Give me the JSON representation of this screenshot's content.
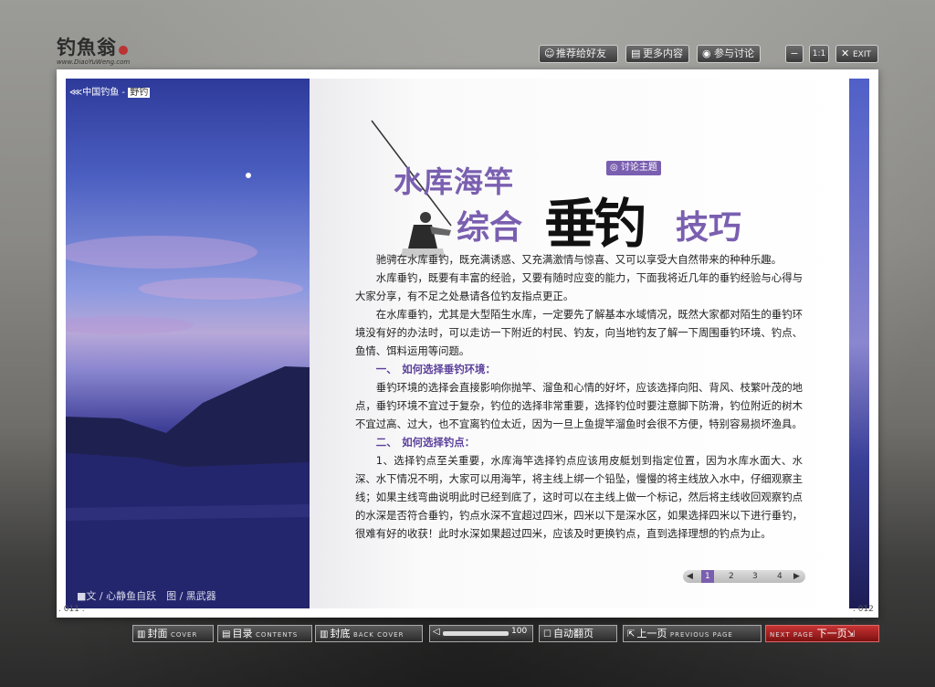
{
  "header": {
    "logo_cn": "钓魚翁",
    "logo_en": "www.DiaoYuWeng.com",
    "buttons": [
      {
        "label": "推荐给好友",
        "icon": "user-recommend-icon"
      },
      {
        "label": "更多内容",
        "icon": "document-icon"
      },
      {
        "label": "参与讨论",
        "icon": "chat-bubble-icon"
      }
    ],
    "window_buttons": [
      {
        "label": "−",
        "name": "minimize"
      },
      {
        "label": "1:1",
        "name": "actual-size"
      },
      {
        "label": "EXIT",
        "name": "exit"
      }
    ]
  },
  "left_page": {
    "category": "中国钓鱼 - ",
    "category_highlight": "野钓",
    "credit": "■文 / 心静鱼自跃　图 / 黑武器",
    "page_number": ". 011 ."
  },
  "right_page": {
    "title_line1": "水库海竿",
    "title_line2_left": "综合",
    "title_calligraphy": "垂钓",
    "title_line2_right": "技巧",
    "badge": "讨论主题",
    "paragraphs": [
      "驰骋在水库垂钓，既充满诱惑、又充满激情与惊喜、又可以享受大自然带来的种种乐趣。",
      "水库垂钓，既要有丰富的经验，又要有随时应变的能力，下面我将近几年的垂钓经验与心得与大家分享，有不足之处悬请各位钓友指点更正。",
      "在水库垂钓，尤其是大型陌生水库，一定要先了解基本水域情况，既然大家都对陌生的垂钓环境没有好的办法时，可以走访一下附近的村民、钓友，向当地钓友了解一下周围垂钓环境、钓点、鱼情、饵料运用等问题。"
    ],
    "section1": "一、　如何选择垂钓环境：",
    "section1_text": "垂钓环境的选择会直接影响你抛竿、溜鱼和心情的好坏，应该选择向阳、背风、枝繁叶茂的地点，垂钓环境不宜过于复杂，钓位的选择非常重要，选择钓位时要注意脚下防滑，钓位附近的树木不宜过高、过大，也不宜离钓位太近，因为一旦上鱼提竿溜鱼时会很不方便，特别容易损坏渔具。",
    "section2": "二、　如何选择钓点：",
    "section2_text": "1、选择钓点至关重要，水库海竿选择钓点应该用皮艇划到指定位置，因为水库水面大、水深、水下情况不明，大家可以用海竿，将主线上绑一个铅坠，慢慢的将主线放入水中，仔细观察主线；如果主线弯曲说明此时已经到底了，这时可以在主线上做一个标记，然后将主线收回观察钓点的水深是否符合垂钓，钓点水深不宜超过四米，四米以下是深水区，如果选择四米以下进行垂钓，很难有好的收获！此时水深如果超过四米，应该及时更换钓点，直到选择理想的钓点为止。",
    "pager": [
      "1",
      "2",
      "3",
      "4"
    ],
    "page_number": ". 012 ."
  },
  "toolbar": {
    "cover": {
      "cn": "封面",
      "en": "COVER"
    },
    "contents": {
      "cn": "目录",
      "en": "CONTENTS"
    },
    "back_cover": {
      "cn": "封底",
      "en": "BACK COVER"
    },
    "volume": "100",
    "auto_flip": "自动翻页",
    "prev": {
      "cn": "上一页",
      "en": "PREVIOUS PAGE"
    },
    "next": {
      "cn": "下一页",
      "en": "NEXT PAGE"
    }
  }
}
